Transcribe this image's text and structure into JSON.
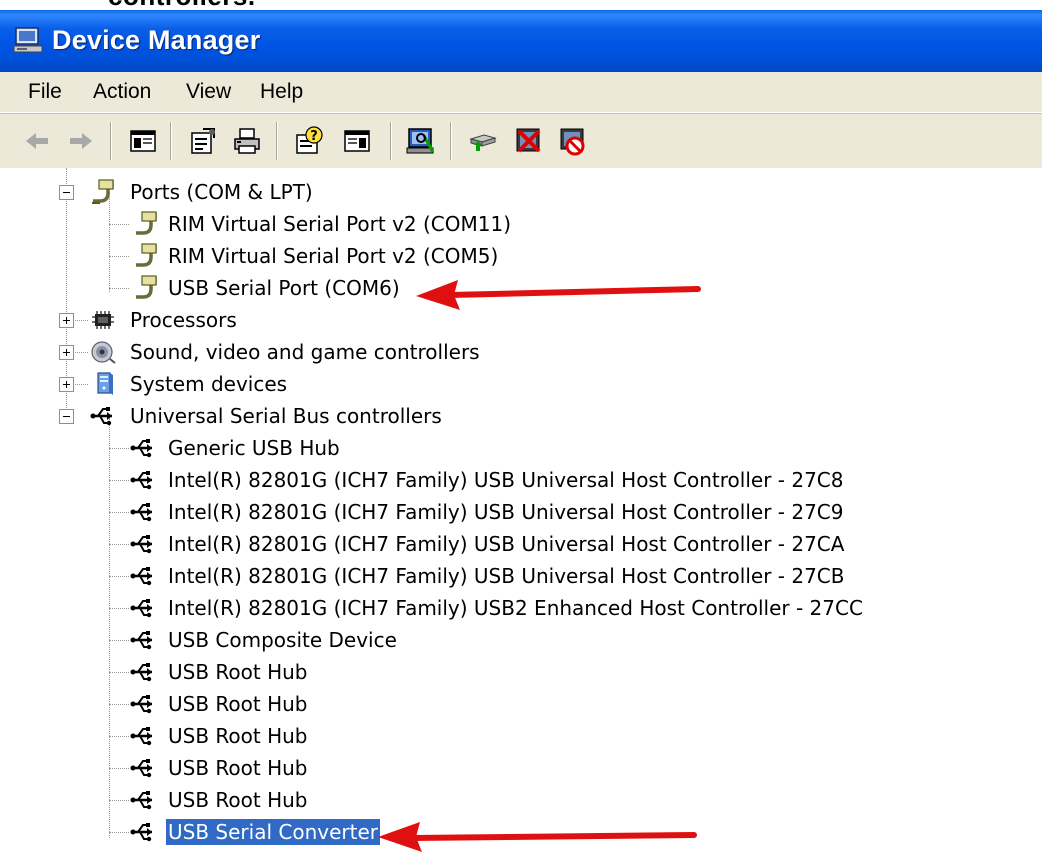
{
  "cropped_heading": "controllers.",
  "window": {
    "title": "Device Manager"
  },
  "menu": [
    "File",
    "Action",
    "View",
    "Help"
  ],
  "toolbar": {
    "buttons": [
      "back-icon",
      "forward-icon",
      "show-hide-console-tree-icon",
      "properties-icon",
      "print-icon",
      "help-icon",
      "show-hide-action-pane-icon",
      "scan-hardware-icon",
      "update-driver-icon",
      "uninstall-icon",
      "disable-icon"
    ]
  },
  "tree": {
    "ports": {
      "label": "Ports (COM & LPT)",
      "children": [
        "RIM Virtual Serial Port v2 (COM11)",
        "RIM Virtual Serial Port v2 (COM5)",
        "USB Serial Port (COM6)"
      ]
    },
    "processors": "Processors",
    "sound": "Sound, video and game controllers",
    "system": "System devices",
    "usb": {
      "label": "Universal Serial Bus controllers",
      "children": [
        "Generic USB Hub",
        "Intel(R) 82801G (ICH7 Family) USB Universal Host Controller - 27C8",
        "Intel(R) 82801G (ICH7 Family) USB Universal Host Controller - 27C9",
        "Intel(R) 82801G (ICH7 Family) USB Universal Host Controller - 27CA",
        "Intel(R) 82801G (ICH7 Family) USB Universal Host Controller - 27CB",
        "Intel(R) 82801G (ICH7 Family) USB2 Enhanced Host Controller - 27CC",
        "USB Composite Device",
        "USB Root Hub",
        "USB Root Hub",
        "USB Root Hub",
        "USB Root Hub",
        "USB Root Hub",
        "USB Serial Converter"
      ]
    }
  },
  "selected_item": "USB Serial Converter",
  "colors": {
    "titlebar": "#0055e5",
    "chrome": "#ece9d8",
    "selection": "#316ac5",
    "annotation_arrow": "#e01010"
  }
}
